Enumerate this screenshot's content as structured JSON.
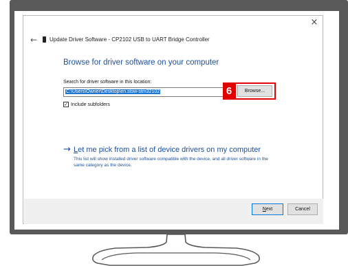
{
  "dialog": {
    "close_glyph": "×",
    "back_glyph": "←",
    "header_title": "Update Driver Software - CP2102 USB to UART Bridge Controller",
    "section_title": "Browse for driver software on your computer",
    "search_label": "Search for driver software in this location:",
    "path_value": "C:\\Users\\Owner\\Desktop\\en.stsw-stm32102",
    "browse_label": "Browse...",
    "include_subfolders_label": "Include subfolders",
    "include_subfolders_checked": true,
    "check_glyph": "✓",
    "pick_arrow_glyph": "→",
    "pick_link_accel": "L",
    "pick_link_rest": "et me pick from a list of device drivers on my computer",
    "pick_description": "This list will show installed driver software compatible with the device, and all driver software in the same category as the device.",
    "next_accel": "N",
    "next_rest": "ext",
    "cancel_label": "Cancel"
  },
  "annotation": {
    "step_number": "6",
    "highlight_color": "#e00000"
  },
  "colors": {
    "link_blue": "#1b4f9c",
    "selection_blue": "#1c76d2",
    "monitor_bezel": "#595959"
  }
}
